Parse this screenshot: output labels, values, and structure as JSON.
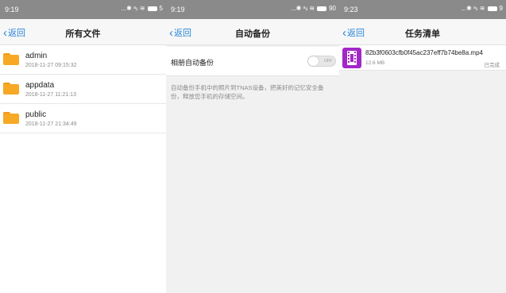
{
  "colors": {
    "accent": "#2a86d8",
    "statusbar": "#8a8a8a",
    "folder": "#f7a824",
    "video_icon": "#a327c8"
  },
  "screens": [
    {
      "status": {
        "time": "9:19",
        "icons": "...✱ ᵃᵢₗ ≋",
        "extra": "5"
      },
      "back_label": "返回",
      "title": "所有文件",
      "files": [
        {
          "name": "admin",
          "date": "2018-11-27 09:15:32",
          "icon": "folder-icon"
        },
        {
          "name": "appdata",
          "date": "2018-11-27 11:21:13",
          "icon": "folder-icon"
        },
        {
          "name": "public",
          "date": "2018-11-27 21:34:49",
          "icon": "folder-icon"
        }
      ]
    },
    {
      "status": {
        "time": "9:19",
        "icons": "...✱ ᵃᵢₗ ≋",
        "extra": "90"
      },
      "back_label": "返回",
      "title": "自动备份",
      "setting_label": "相册自动备份",
      "toggle_text": "OFF",
      "toggle_on": false,
      "description": "自动备份手机中的照片到TNAS设备，把美好的记忆安全备份，释放您手机的存储空间。"
    },
    {
      "status": {
        "time": "9:23",
        "icons": "...✱ ᵃᵢₗ ≋",
        "extra": "9"
      },
      "back_label": "返回",
      "title": "任务清单",
      "tasks": [
        {
          "name": "82b3f0603cfb0f45ac237eff7b74be8a.mp4",
          "size": "12.6 MB",
          "status": "已完成",
          "icon": "video-file-icon"
        }
      ]
    }
  ]
}
